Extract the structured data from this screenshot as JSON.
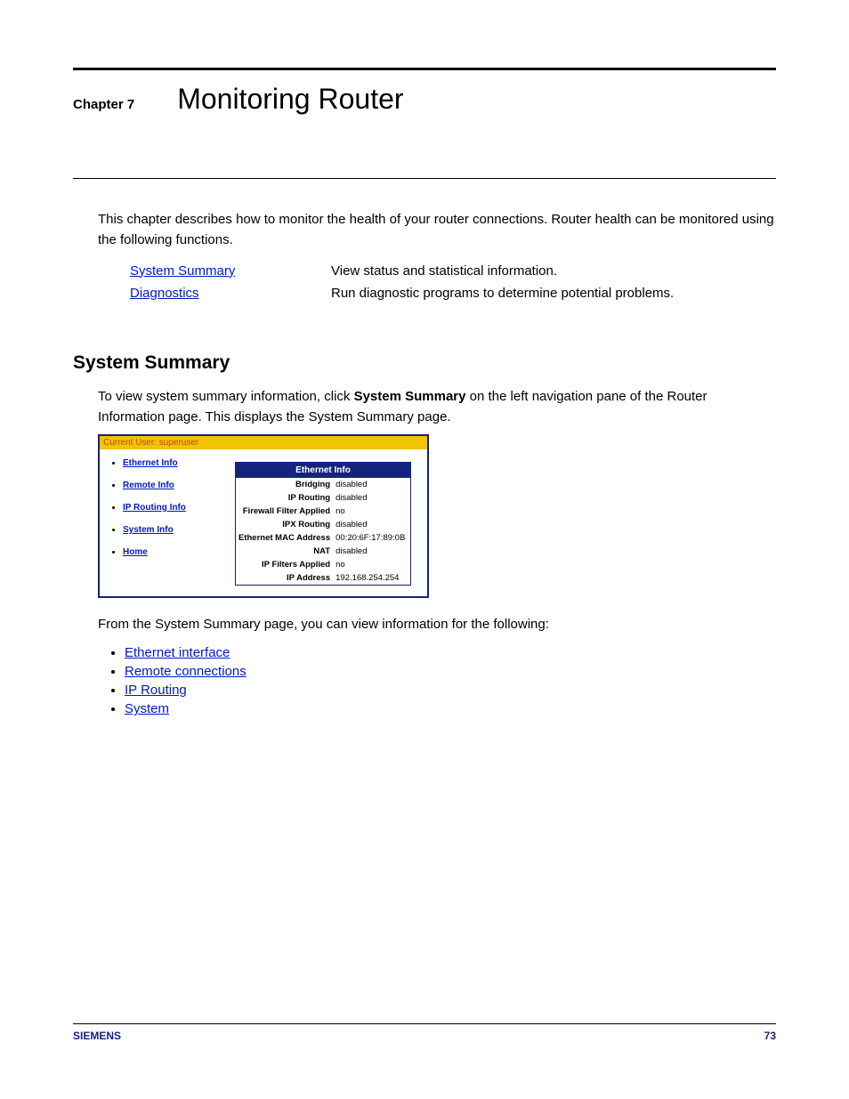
{
  "chapter": {
    "label": "Chapter 7",
    "title": "Monitoring Router"
  },
  "intro": "This chapter describes how to monitor the health of your router connections. Router health can be monitored using the following functions.",
  "functions": [
    {
      "name": "System Summary",
      "desc": "View status and statistical information."
    },
    {
      "name": "Diagnostics",
      "desc": "Run diagnostic programs to determine potential problems."
    }
  ],
  "section": {
    "heading": "System Summary",
    "body_pre": "To view system summary information, click ",
    "body_bold": "System Summary",
    "body_post": " on the left navigation pane of the Router Information page. This displays the System Summary page."
  },
  "app_shot": {
    "user_bar": "Current User: superuser",
    "nav": [
      "Ethernet Info",
      "Remote Info",
      "IP Routing Info",
      "System Info",
      "Home"
    ],
    "panel_title": "Ethernet Info",
    "rows": [
      {
        "k": "Bridging",
        "v": "disabled"
      },
      {
        "k": "IP Routing",
        "v": "disabled"
      },
      {
        "k": "Firewall Filter Applied",
        "v": "no"
      },
      {
        "k": "IPX Routing",
        "v": "disabled"
      },
      {
        "k": "Ethernet MAC Address",
        "v": "00:20:6F:17:89:0B"
      },
      {
        "k": "NAT",
        "v": "disabled"
      },
      {
        "k": "IP Filters Applied",
        "v": "no"
      },
      {
        "k": "IP Address",
        "v": "192.168.254.254"
      }
    ]
  },
  "after_shot": "From the System Summary page, you can view information for the following:",
  "view_links": [
    "Ethernet interface",
    "Remote connections",
    "IP Routing",
    "System"
  ],
  "footer": {
    "brand": "SIEMENS",
    "page": "73"
  }
}
